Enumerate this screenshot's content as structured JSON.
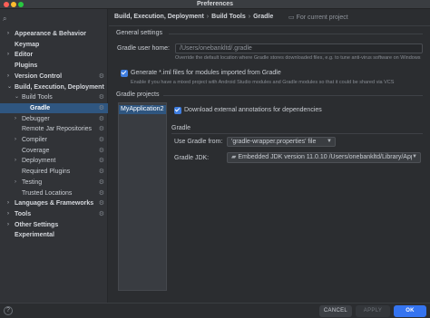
{
  "window": {
    "title": "Preferences"
  },
  "sidebar": {
    "search_icon": "search-icon",
    "items": [
      {
        "label": "Appearance & Behavior",
        "chevron": "›",
        "bold": true
      },
      {
        "label": "Keymap",
        "chevron": "",
        "bold": true
      },
      {
        "label": "Editor",
        "chevron": "›",
        "bold": true
      },
      {
        "label": "Plugins",
        "chevron": "",
        "bold": true
      },
      {
        "label": "Version Control",
        "chevron": "›",
        "bold": true
      },
      {
        "label": "Build, Execution, Deployment",
        "chevron": "⌄",
        "bold": true
      },
      {
        "label": "Build Tools",
        "chevron": "⌄",
        "bold": false
      },
      {
        "label": "Gradle",
        "chevron": "",
        "bold": true
      },
      {
        "label": "Debugger",
        "chevron": "›",
        "bold": false
      },
      {
        "label": "Remote Jar Repositories",
        "chevron": "",
        "bold": false
      },
      {
        "label": "Compiler",
        "chevron": "›",
        "bold": false
      },
      {
        "label": "Coverage",
        "chevron": "",
        "bold": false
      },
      {
        "label": "Deployment",
        "chevron": "›",
        "bold": false
      },
      {
        "label": "Required Plugins",
        "chevron": "",
        "bold": false
      },
      {
        "label": "Testing",
        "chevron": "›",
        "bold": false
      },
      {
        "label": "Trusted Locations",
        "chevron": "",
        "bold": false
      },
      {
        "label": "Languages & Frameworks",
        "chevron": "›",
        "bold": true
      },
      {
        "label": "Tools",
        "chevron": "›",
        "bold": true
      },
      {
        "label": "Other Settings",
        "chevron": "›",
        "bold": true
      },
      {
        "label": "Experimental",
        "chevron": "",
        "bold": true
      }
    ]
  },
  "header": {
    "crumb1": "Build, Execution, Deployment",
    "crumb2": "Build Tools",
    "crumb3": "Gradle",
    "separator": "›",
    "project_scope": "For current project"
  },
  "general": {
    "title": "General settings",
    "user_home_label": "Gradle user home:",
    "user_home_value": "/Users/onebankltd/.gradle",
    "user_home_hint": "Override the default location where Gradle stores downloaded files, e.g. to tune anti-virus software on Windows",
    "generate_iml_label": "Generate *.iml files for modules imported from Gradle",
    "generate_iml_hint": "Enable if you have a mixed project with Android Studio modules and Gradle modules so that it could be shared via VCS"
  },
  "projects": {
    "title": "Gradle projects",
    "list": [
      "MyApplication2"
    ],
    "download_annotations_label": "Download external annotations for dependencies",
    "gradle_section": "Gradle",
    "use_gradle_from_label": "Use Gradle from:",
    "use_gradle_from_value": "'gradle-wrapper.properties' file",
    "gradle_jdk_label": "Gradle JDK:",
    "gradle_jdk_value": "Embedded JDK version 11.0.10 /Users/onebankltd/Library/Appl"
  },
  "footer": {
    "help": "?",
    "cancel": "CANCEL",
    "apply": "APPLY",
    "ok": "OK"
  }
}
